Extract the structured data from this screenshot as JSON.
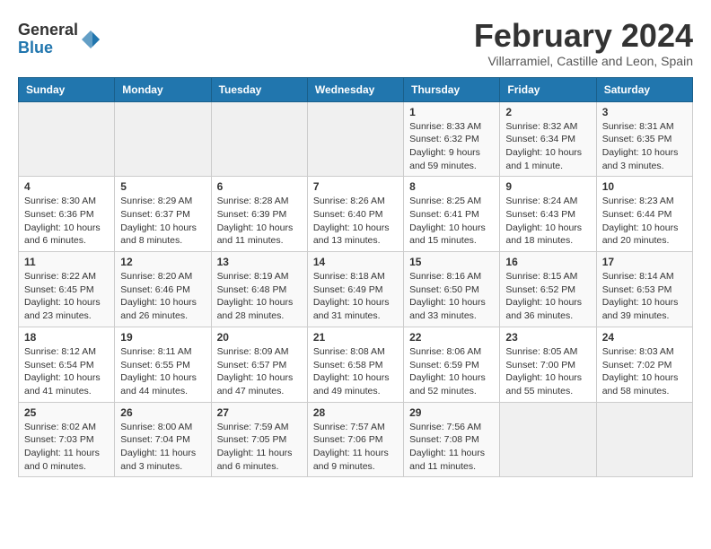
{
  "header": {
    "logo_general": "General",
    "logo_blue": "Blue",
    "month_title": "February 2024",
    "location": "Villarramiel, Castille and Leon, Spain"
  },
  "weekdays": [
    "Sunday",
    "Monday",
    "Tuesday",
    "Wednesday",
    "Thursday",
    "Friday",
    "Saturday"
  ],
  "weeks": [
    [
      {
        "day": "",
        "info": ""
      },
      {
        "day": "",
        "info": ""
      },
      {
        "day": "",
        "info": ""
      },
      {
        "day": "",
        "info": ""
      },
      {
        "day": "1",
        "info": "Sunrise: 8:33 AM\nSunset: 6:32 PM\nDaylight: 9 hours\nand 59 minutes."
      },
      {
        "day": "2",
        "info": "Sunrise: 8:32 AM\nSunset: 6:34 PM\nDaylight: 10 hours\nand 1 minute."
      },
      {
        "day": "3",
        "info": "Sunrise: 8:31 AM\nSunset: 6:35 PM\nDaylight: 10 hours\nand 3 minutes."
      }
    ],
    [
      {
        "day": "4",
        "info": "Sunrise: 8:30 AM\nSunset: 6:36 PM\nDaylight: 10 hours\nand 6 minutes."
      },
      {
        "day": "5",
        "info": "Sunrise: 8:29 AM\nSunset: 6:37 PM\nDaylight: 10 hours\nand 8 minutes."
      },
      {
        "day": "6",
        "info": "Sunrise: 8:28 AM\nSunset: 6:39 PM\nDaylight: 10 hours\nand 11 minutes."
      },
      {
        "day": "7",
        "info": "Sunrise: 8:26 AM\nSunset: 6:40 PM\nDaylight: 10 hours\nand 13 minutes."
      },
      {
        "day": "8",
        "info": "Sunrise: 8:25 AM\nSunset: 6:41 PM\nDaylight: 10 hours\nand 15 minutes."
      },
      {
        "day": "9",
        "info": "Sunrise: 8:24 AM\nSunset: 6:43 PM\nDaylight: 10 hours\nand 18 minutes."
      },
      {
        "day": "10",
        "info": "Sunrise: 8:23 AM\nSunset: 6:44 PM\nDaylight: 10 hours\nand 20 minutes."
      }
    ],
    [
      {
        "day": "11",
        "info": "Sunrise: 8:22 AM\nSunset: 6:45 PM\nDaylight: 10 hours\nand 23 minutes."
      },
      {
        "day": "12",
        "info": "Sunrise: 8:20 AM\nSunset: 6:46 PM\nDaylight: 10 hours\nand 26 minutes."
      },
      {
        "day": "13",
        "info": "Sunrise: 8:19 AM\nSunset: 6:48 PM\nDaylight: 10 hours\nand 28 minutes."
      },
      {
        "day": "14",
        "info": "Sunrise: 8:18 AM\nSunset: 6:49 PM\nDaylight: 10 hours\nand 31 minutes."
      },
      {
        "day": "15",
        "info": "Sunrise: 8:16 AM\nSunset: 6:50 PM\nDaylight: 10 hours\nand 33 minutes."
      },
      {
        "day": "16",
        "info": "Sunrise: 8:15 AM\nSunset: 6:52 PM\nDaylight: 10 hours\nand 36 minutes."
      },
      {
        "day": "17",
        "info": "Sunrise: 8:14 AM\nSunset: 6:53 PM\nDaylight: 10 hours\nand 39 minutes."
      }
    ],
    [
      {
        "day": "18",
        "info": "Sunrise: 8:12 AM\nSunset: 6:54 PM\nDaylight: 10 hours\nand 41 minutes."
      },
      {
        "day": "19",
        "info": "Sunrise: 8:11 AM\nSunset: 6:55 PM\nDaylight: 10 hours\nand 44 minutes."
      },
      {
        "day": "20",
        "info": "Sunrise: 8:09 AM\nSunset: 6:57 PM\nDaylight: 10 hours\nand 47 minutes."
      },
      {
        "day": "21",
        "info": "Sunrise: 8:08 AM\nSunset: 6:58 PM\nDaylight: 10 hours\nand 49 minutes."
      },
      {
        "day": "22",
        "info": "Sunrise: 8:06 AM\nSunset: 6:59 PM\nDaylight: 10 hours\nand 52 minutes."
      },
      {
        "day": "23",
        "info": "Sunrise: 8:05 AM\nSunset: 7:00 PM\nDaylight: 10 hours\nand 55 minutes."
      },
      {
        "day": "24",
        "info": "Sunrise: 8:03 AM\nSunset: 7:02 PM\nDaylight: 10 hours\nand 58 minutes."
      }
    ],
    [
      {
        "day": "25",
        "info": "Sunrise: 8:02 AM\nSunset: 7:03 PM\nDaylight: 11 hours\nand 0 minutes."
      },
      {
        "day": "26",
        "info": "Sunrise: 8:00 AM\nSunset: 7:04 PM\nDaylight: 11 hours\nand 3 minutes."
      },
      {
        "day": "27",
        "info": "Sunrise: 7:59 AM\nSunset: 7:05 PM\nDaylight: 11 hours\nand 6 minutes."
      },
      {
        "day": "28",
        "info": "Sunrise: 7:57 AM\nSunset: 7:06 PM\nDaylight: 11 hours\nand 9 minutes."
      },
      {
        "day": "29",
        "info": "Sunrise: 7:56 AM\nSunset: 7:08 PM\nDaylight: 11 hours\nand 11 minutes."
      },
      {
        "day": "",
        "info": ""
      },
      {
        "day": "",
        "info": ""
      }
    ]
  ]
}
